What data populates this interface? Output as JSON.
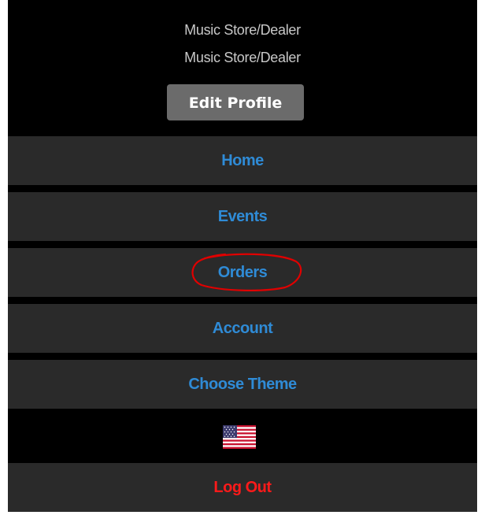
{
  "profile": {
    "line1": "Music Store/Dealer",
    "line2": "Music Store/Dealer",
    "edit_label": "Edit Profile"
  },
  "nav": {
    "items": [
      {
        "label": "Home"
      },
      {
        "label": "Events"
      },
      {
        "label": "Orders"
      },
      {
        "label": "Account"
      },
      {
        "label": "Choose Theme"
      }
    ],
    "logout_label": "Log Out"
  },
  "language": {
    "flag_icon": "us-flag-icon"
  },
  "colors": {
    "background": "#000000",
    "row": "#2a2a2a",
    "link": "#2f8bd6",
    "logout": "#ff1a1a",
    "edit_button": "#6b6b6b",
    "annotation": "#e00000"
  }
}
